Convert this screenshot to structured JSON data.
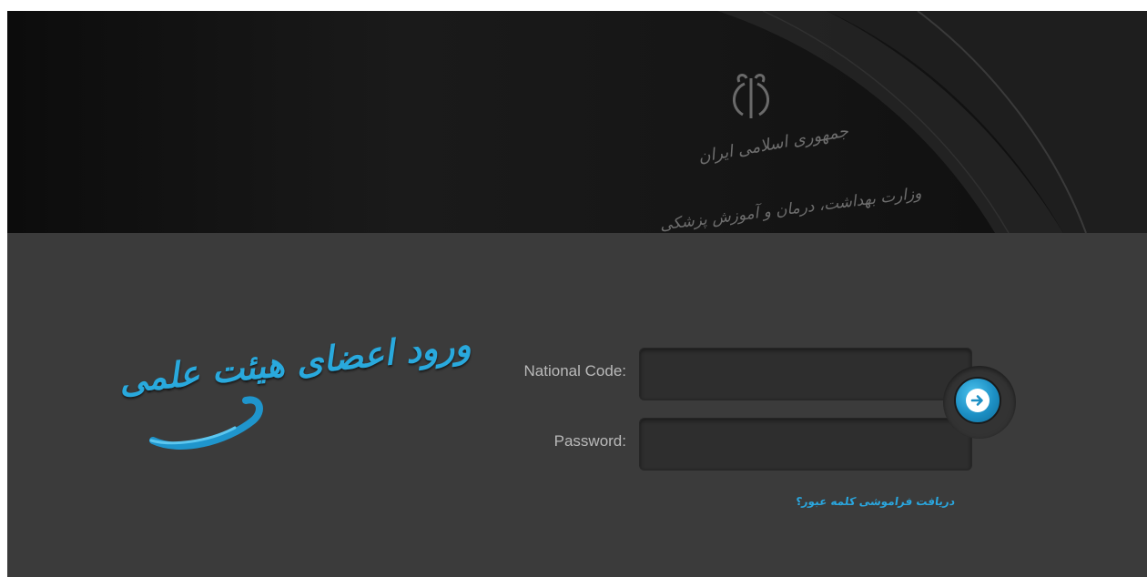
{
  "header": {
    "emblem_line_1": "جمهوری اسلامی ایران",
    "emblem_line_2": "وزارت بهداشت، درمان و آموزش پزشکی"
  },
  "login": {
    "title": "ورود اعضای هیئت علمی",
    "national_code_label": "National Code:",
    "national_code_value": "",
    "password_label": "Password:",
    "password_value": "",
    "forgot_password_link": "دریافت فراموشی کلمه عبور؟",
    "submit_icon": "arrow-right-icon"
  },
  "colors": {
    "accent": "#29a9dd",
    "header_bg": "#141414",
    "body_bg": "#3b3b3b",
    "input_bg": "#2e2e2e",
    "label": "#b9b9b9"
  }
}
